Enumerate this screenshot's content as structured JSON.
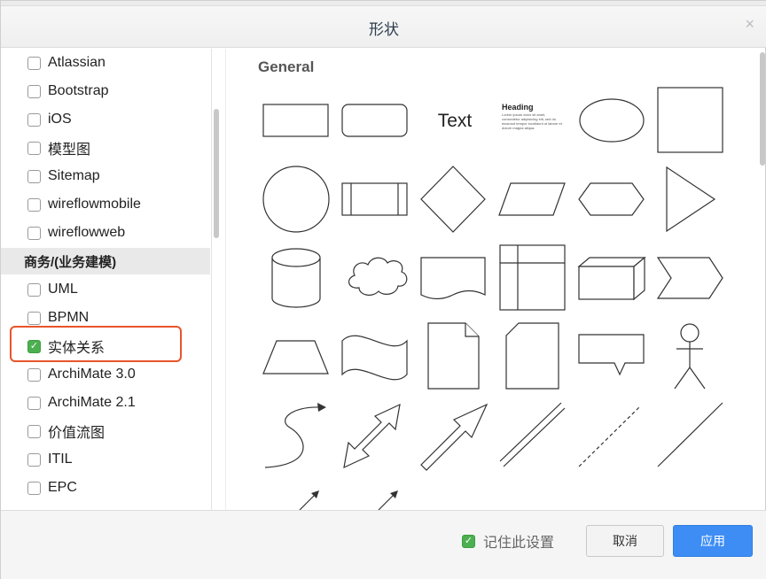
{
  "dialog": {
    "title": "形状",
    "close_glyph": "×"
  },
  "left": {
    "items_top": [
      {
        "label": "Atlassian",
        "checked": false
      },
      {
        "label": "Bootstrap",
        "checked": false
      },
      {
        "label": "iOS",
        "checked": false
      },
      {
        "label": "模型图",
        "checked": false
      },
      {
        "label": "Sitemap",
        "checked": false
      },
      {
        "label": "wireflowmobile",
        "checked": false
      },
      {
        "label": "wireflowweb",
        "checked": false
      }
    ],
    "category": "商务/(业务建模)",
    "items_bottom": [
      {
        "label": "UML",
        "checked": false
      },
      {
        "label": "BPMN",
        "checked": false
      },
      {
        "label": "实体关系",
        "checked": true
      },
      {
        "label": "ArchiMate 3.0",
        "checked": false
      },
      {
        "label": "ArchiMate 2.1",
        "checked": false
      },
      {
        "label": "价值流图",
        "checked": false
      },
      {
        "label": "ITIL",
        "checked": false
      },
      {
        "label": "EPC",
        "checked": false
      }
    ]
  },
  "right": {
    "section_title": "General",
    "text_shape_label": "Text",
    "heading_shape_label": "Heading",
    "heading_shape_body": "Lorem ipsum dolor sit amet, consectetur adipisicing elit, sed do eiusmod tempor incididunt ut labore et dolore magna aliqua."
  },
  "footer": {
    "remember_label": "记住此设置",
    "remember_checked": true,
    "cancel_label": "取消",
    "apply_label": "应用"
  },
  "colors": {
    "accent": "#3d8df5",
    "checkbox_checked": "#4caf50",
    "highlight_border": "#e8542a"
  }
}
